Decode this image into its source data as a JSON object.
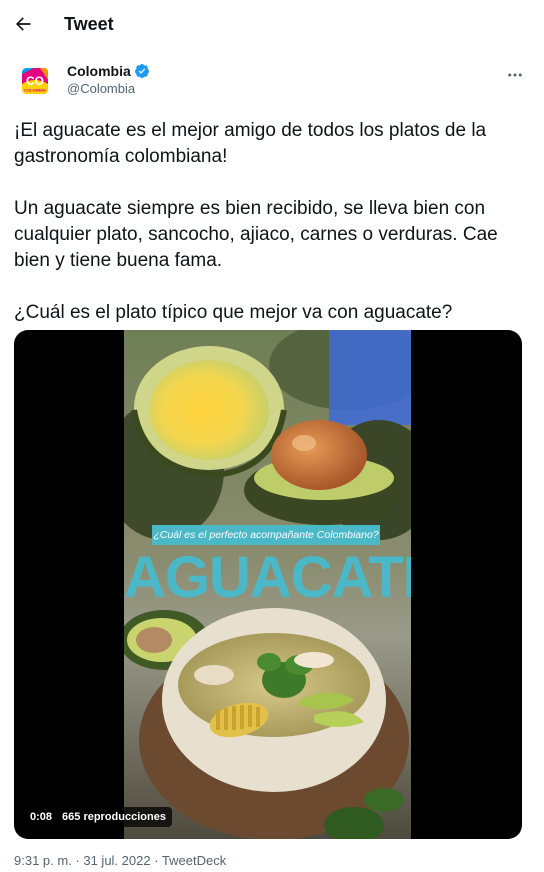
{
  "header": {
    "title": "Tweet",
    "back_icon": "arrow-left-icon"
  },
  "author": {
    "name": "Colombia",
    "handle": "@Colombia",
    "verified": true,
    "avatar_text": "CO",
    "avatar_subtext": "COLOMBIA",
    "verified_color": "#1d9bf0"
  },
  "tweet": {
    "line1": "¡El aguacate es el mejor amigo de todos los platos de la gastronomía colombiana!",
    "line2": "Un aguacate siempre es bien recibido, se lleva bien con cualquier plato, sancocho, ajiaco, carnes o verduras. Cae bien y tiene buena fama.",
    "line3": "¿Cuál es el plato típico que mejor va con aguacate?"
  },
  "media": {
    "overlay_question": "¿Cuál es el perfecto acompañante Colombiano?",
    "overlay_title": "AGUACATE",
    "duration": "0:08",
    "views": "665 reproducciones",
    "accent_color": "#4bb8c8"
  },
  "meta": {
    "info": "9:31 p. m. · 31 jul. 2022 · TweetDeck"
  }
}
